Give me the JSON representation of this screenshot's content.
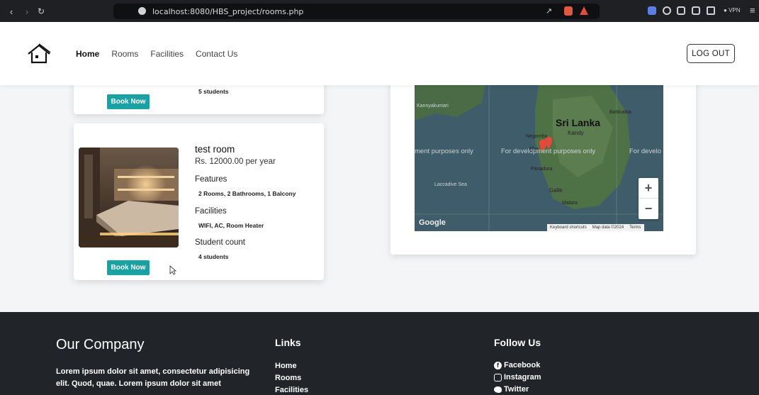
{
  "browser": {
    "url": "localhost:8080/HBS_project/rooms.php",
    "vpn_label": "VPN"
  },
  "header": {
    "nav": [
      "Home",
      "Rooms",
      "Facilities",
      "Contact Us"
    ],
    "logout_label": "LOG OUT"
  },
  "rooms": [
    {
      "student_count_value": "5 students",
      "book_label": "Book Now"
    },
    {
      "title": "test room",
      "price": "Rs. 12000.00 per year",
      "features_heading": "Features",
      "features": "2 Rooms, 2 Bathrooms, 1 Balcony",
      "facilities_heading": "Facilities",
      "facilities": "WIFI, AC, Room Heater",
      "student_heading": "Student count",
      "student_count_value": "4 students",
      "book_label": "Book Now"
    }
  ],
  "map": {
    "country_label": "Sri Lanka",
    "places": [
      "Kandy",
      "Negombo",
      "Co",
      "Panadura",
      "Galle",
      "Matara",
      "Batticaloa",
      "Kannyakumari",
      "Laccadive Sea"
    ],
    "watermark": [
      "ment purposes only",
      "For development purposes only",
      "For develo"
    ],
    "attribution": [
      "Keyboard shortcuts",
      "Map data ©2024",
      "Terms"
    ],
    "google_label": "Google",
    "zoom_in": "+",
    "zoom_out": "−"
  },
  "footer": {
    "company_title": "Our Company",
    "company_text": "Lorem ipsum dolor sit amet, consectetur adipisicing elit. Quod, quae. Lorem ipsum dolor sit amet",
    "links_heading": "Links",
    "links": [
      "Home",
      "Rooms",
      "Facilities"
    ],
    "follow_heading": "Follow Us",
    "social": [
      "Facebook",
      "Instagram",
      "Twitter"
    ]
  },
  "colors": {
    "accent": "#17a2a4",
    "footer_bg": "#212529",
    "chrome_bg": "#1f2024"
  }
}
